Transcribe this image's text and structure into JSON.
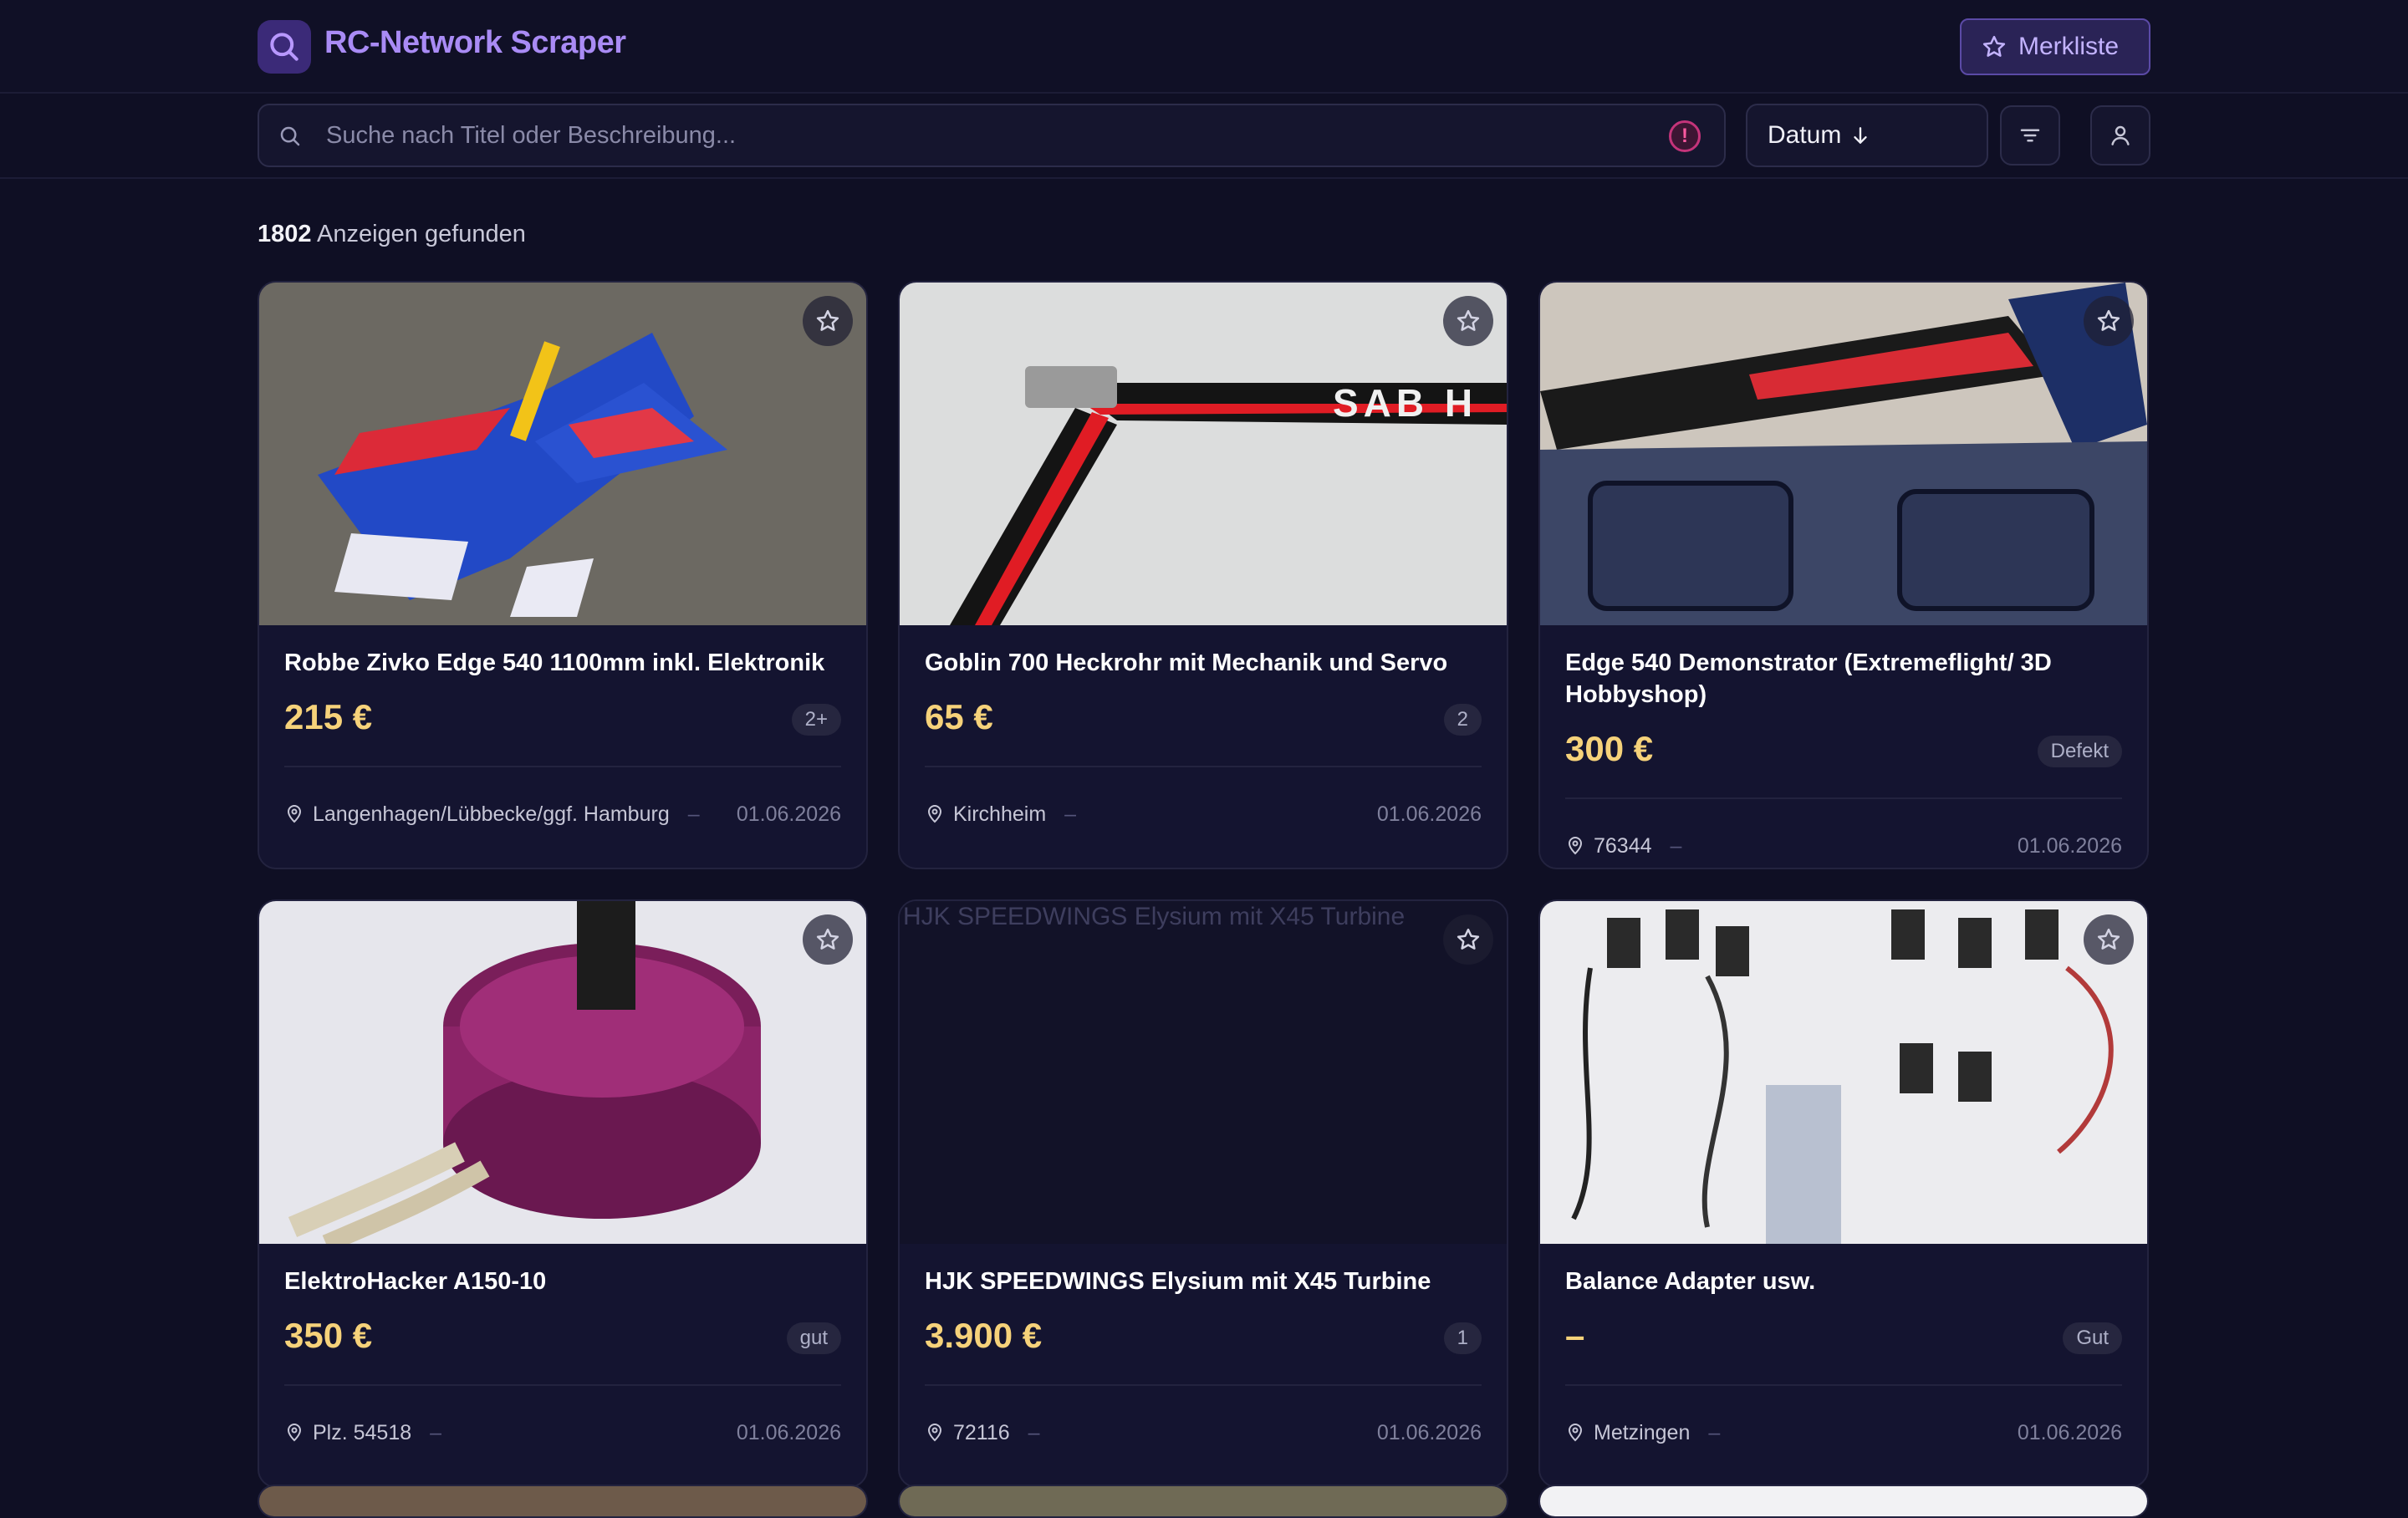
{
  "app": {
    "title": "RC-Network Scraper",
    "merkliste_label": "Merkliste",
    "accent": "#a98bf5",
    "price_color": "#f6d27a"
  },
  "search": {
    "placeholder": "Suche nach Titel oder Beschreibung...",
    "value": ""
  },
  "sort": {
    "label": "Datum",
    "direction_icon": "arrow-down-icon"
  },
  "results": {
    "count": "1802",
    "suffix": "Anzeigen gefunden"
  },
  "listings": [
    {
      "title": "Robbe Zivko Edge 540 1100mm inkl. Elektronik",
      "price": "215 €",
      "badge": "2+",
      "location": "Langenhagen/Lübbecke/ggf. Hamburg",
      "dash": "–",
      "date": "01.06.2026"
    },
    {
      "title": "Goblin 700 Heckrohr mit Mechanik und Servo",
      "price": "65 €",
      "badge": "2",
      "location": "Kirchheim",
      "dash": "–",
      "date": "01.06.2026"
    },
    {
      "title": "Edge 540 Demonstrator (Extremeflight/ 3D Hobbyshop)",
      "price": "300 €",
      "badge": "Defekt",
      "location": "76344",
      "dash": "–",
      "date": "01.06.2026"
    },
    {
      "title": "ElektroHacker A150-10",
      "price": "350 €",
      "badge": "gut",
      "location": "Plz. 54518",
      "dash": "–",
      "date": "01.06.2026"
    },
    {
      "title": "HJK SPEEDWINGS Elysium mit X45 Turbine",
      "price": "3.900 €",
      "badge": "1",
      "location": "72116",
      "dash": "–",
      "date": "01.06.2026",
      "image_alt": "HJK SPEEDWINGS Elysium mit X45 Turbine"
    },
    {
      "title": "Balance Adapter usw.",
      "price": "–",
      "badge": "Gut",
      "location": "Metzingen",
      "dash": "–",
      "date": "01.06.2026"
    }
  ]
}
